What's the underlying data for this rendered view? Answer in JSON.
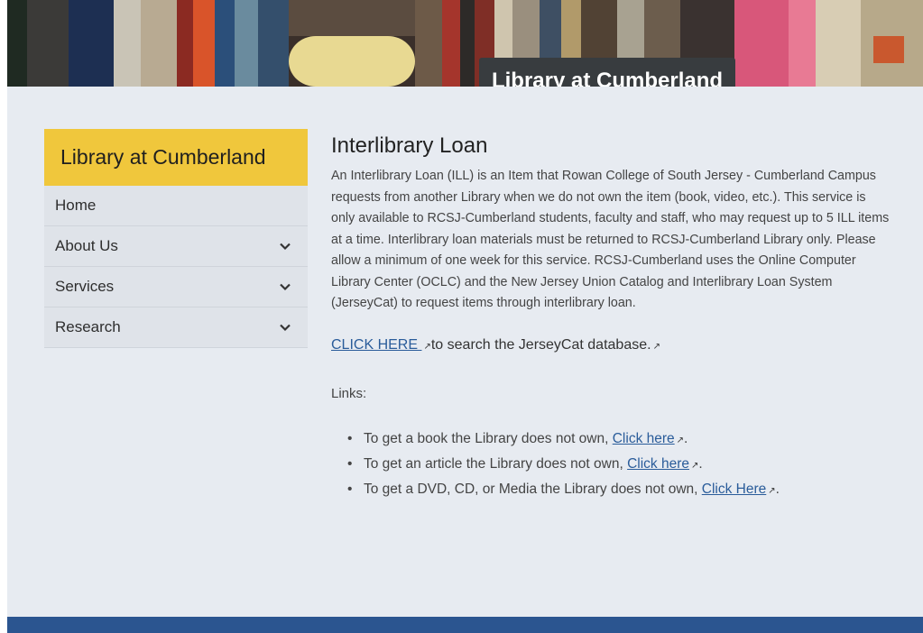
{
  "banner": {
    "title": "Library at Cumberland"
  },
  "sidebar": {
    "heading": "Library at Cumberland",
    "items": [
      {
        "label": "Home",
        "has_dropdown": false
      },
      {
        "label": "About Us",
        "has_dropdown": true
      },
      {
        "label": "Services",
        "has_dropdown": true
      },
      {
        "label": "Research",
        "has_dropdown": true
      }
    ]
  },
  "main": {
    "title": "Interlibrary Loan",
    "intro": "An Interlibrary Loan (ILL) is an Item that Rowan College of South Jersey - Cumberland Campus requests from another Library when we do not own the item (book, video, etc.). This service is only available to RCSJ-Cumberland students, faculty and staff, who may request up to 5 ILL items at a time. Interlibrary loan materials must be returned to RCSJ-Cumberland Library only. Please allow a minimum of one week for this service.   RCSJ-Cumberland uses the Online Computer Library Center (OCLC) and the New Jersey Union Catalog and Interlibrary Loan System (JerseyCat) to request items through interlibrary loan.",
    "cta_link": "CLICK HERE ",
    "cta_text": "to search the JerseyCat database.",
    "links_label": "Links:",
    "links": [
      {
        "text": "To get a book the Library does not own, ",
        "link": "Click here"
      },
      {
        "text": "To get an article the Library does not own, ",
        "link": "Click here"
      },
      {
        "text": "To get a DVD, CD, or Media the Library does not own, ",
        "link": "Click Here"
      }
    ]
  },
  "icons": {
    "external": "external-link-icon",
    "dropdown": "chevron-down-icon"
  },
  "colors": {
    "sidebar_heading_bg": "#f0c73c",
    "banner_title_bg": "#383c3f",
    "link": "#2a5c9a",
    "footer": "#2b5590",
    "page_bg": "#e7ebf1"
  }
}
